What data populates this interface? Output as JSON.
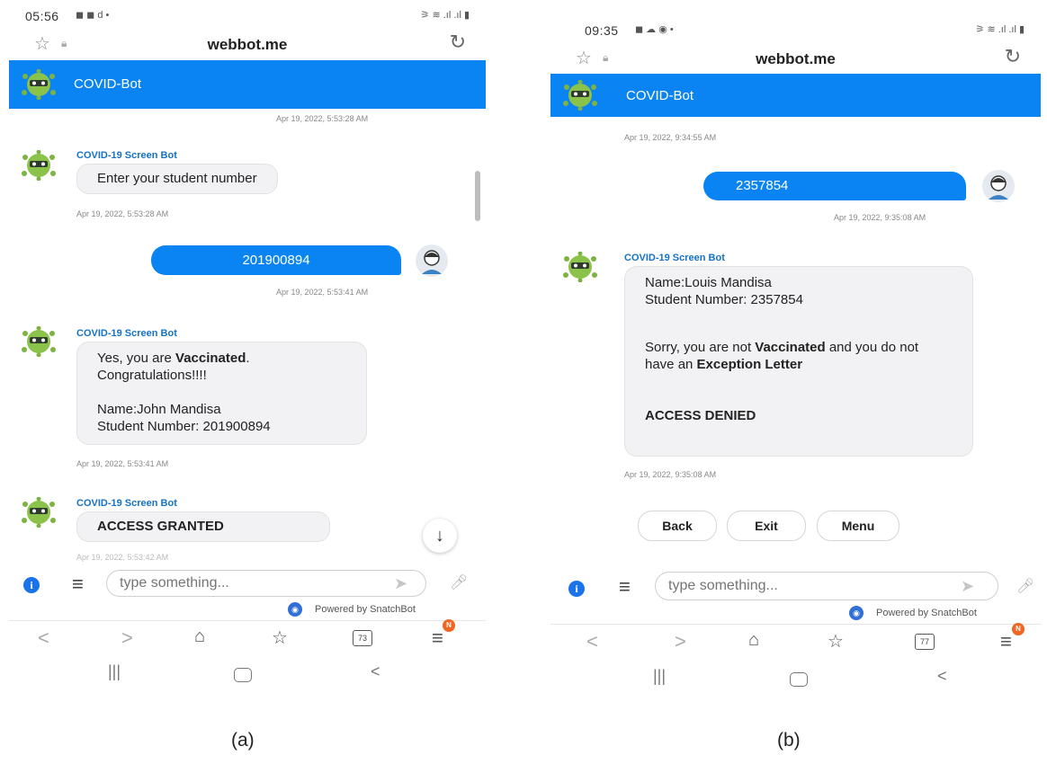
{
  "captions": [
    "(a)",
    "(b)"
  ],
  "common": {
    "domain": "webbot.me",
    "bot_header_name": "COVID-Bot",
    "bot_name": "COVID-19 Screen Bot",
    "input_placeholder": "type something...",
    "powered_by": "Powered by SnatchBot",
    "nav_back": "<",
    "nav_forward": ">",
    "brand_color": "#0b84f3"
  },
  "phone_a": {
    "time": "05:56",
    "status_icons": "◼ ◼ d •",
    "signal": "⚞ ≋ .ıl .ıl ▮",
    "ts_header": "Apr 19, 2022, 5:53:28 AM",
    "msg1": "Enter your student number",
    "ts1": "Apr 19, 2022, 5:53:28 AM",
    "user_msg": "201900894",
    "ts2": "Apr 19, 2022, 5:53:41 AM",
    "msg2_prefix": "Yes, you are ",
    "msg2_bold": "Vaccinated",
    "msg2_suffix": ".",
    "msg2_line2": "Congratulations!!!!",
    "msg2_name": "Name:John Mandisa",
    "msg2_student": "Student Number: 201900894",
    "ts3": "Apr 19, 2022, 5:53:41 AM",
    "msg3": "ACCESS GRANTED",
    "ts4": "Apr 19, 2022, 5:53:42 AM",
    "tab_count": "73",
    "badge": "N"
  },
  "phone_b": {
    "time": "09:35",
    "status_icons": "◼ ☁ ◉ •",
    "signal": "⚞ ≋ .ıl .ıl ▮",
    "ts_header": "Apr 19, 2022, 9:34:55 AM",
    "user_msg": "2357854",
    "ts1": "Apr 19, 2022, 9:35:08 AM",
    "msg_name": "Name:Louis Mandisa",
    "msg_student": "Student Number: 2357854",
    "msg_sorry_prefix": "Sorry, you are not ",
    "msg_sorry_bold1": "Vaccinated",
    "msg_sorry_mid": " and you do not have an ",
    "msg_sorry_bold2": "Exception Letter",
    "msg_denied": "ACCESS DENIED",
    "ts2": "Apr 19, 2022, 9:35:08 AM",
    "quick_replies": [
      "Back",
      "Exit",
      "Menu"
    ],
    "tab_count": "77",
    "badge": "N"
  }
}
